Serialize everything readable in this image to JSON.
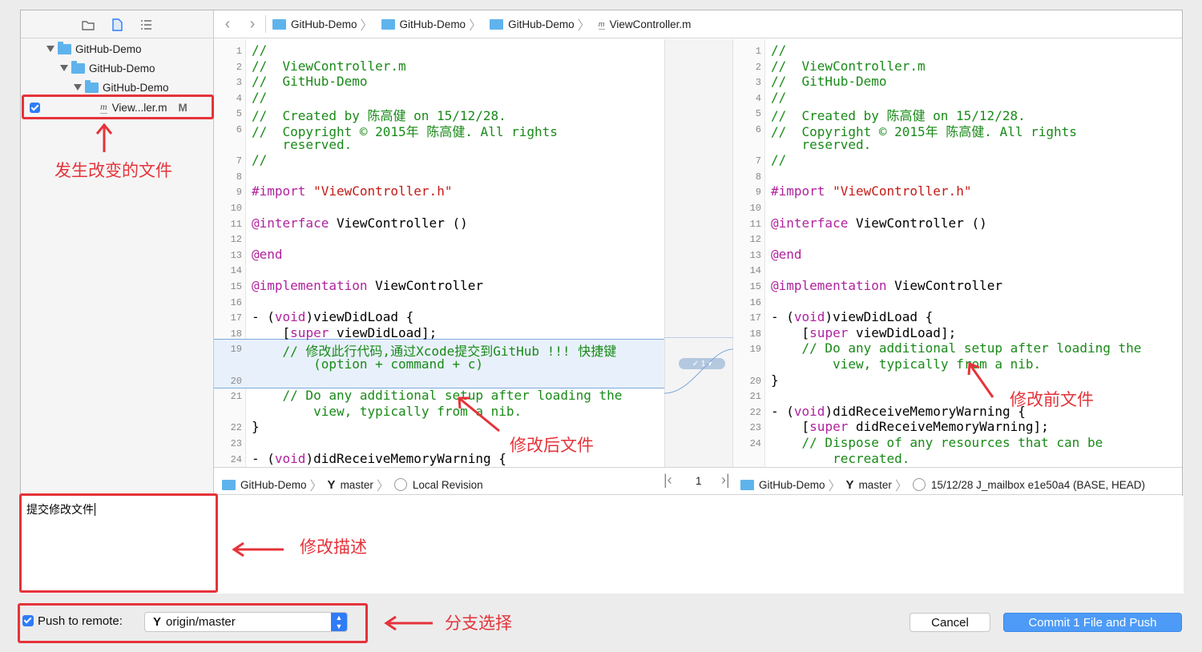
{
  "colors": {
    "accent": "#2f7cf6",
    "annotation": "#e5333a",
    "comment": "#198a18",
    "keyword": "#b0229e",
    "string": "#c41a16"
  },
  "sidebar": {
    "toolbar_icons": [
      "folder-icon",
      "file-icon",
      "list-icon"
    ],
    "tree": [
      {
        "label": "GitHub-Demo"
      },
      {
        "label": "GitHub-Demo"
      },
      {
        "label": "GitHub-Demo"
      },
      {
        "label": "View...ler.m",
        "status": "M"
      }
    ]
  },
  "jumpbar": {
    "crumbs": [
      "GitHub-Demo",
      "GitHub-Demo",
      "GitHub-Demo",
      "ViewController.m"
    ]
  },
  "left_editor": {
    "lines": [
      {
        "n": "1",
        "t": "//",
        "c": "cm"
      },
      {
        "n": "2",
        "t": "//  ViewController.m",
        "c": "cm"
      },
      {
        "n": "3",
        "t": "//  GitHub-Demo",
        "c": "cm"
      },
      {
        "n": "4",
        "t": "//",
        "c": "cm"
      },
      {
        "n": "5",
        "t": "//  Created by 陈高健 on 15/12/28.",
        "c": "cm"
      },
      {
        "n": "6",
        "t": "//  Copyright © 2015年 陈高健. All rights",
        "c": "cm"
      },
      {
        "n": "",
        "t": "    reserved.",
        "c": "cm"
      },
      {
        "n": "7",
        "t": "//",
        "c": "cm"
      },
      {
        "n": "8",
        "t": "",
        "c": ""
      },
      {
        "n": "9",
        "t": "#import \"ViewController.h\"",
        "c": "imp"
      },
      {
        "n": "10",
        "t": "",
        "c": ""
      },
      {
        "n": "11",
        "t": "@interface ViewController ()",
        "c": "iface"
      },
      {
        "n": "12",
        "t": "",
        "c": ""
      },
      {
        "n": "13",
        "t": "@end",
        "c": "kw"
      },
      {
        "n": "14",
        "t": "",
        "c": ""
      },
      {
        "n": "15",
        "t": "@implementation ViewController",
        "c": "impl"
      },
      {
        "n": "16",
        "t": "",
        "c": ""
      },
      {
        "n": "17",
        "t": "- (void)viewDidLoad {",
        "c": "meth"
      },
      {
        "n": "18",
        "t": "    [super viewDidLoad];",
        "c": "super"
      },
      {
        "n": "19",
        "t": "    // 修改此行代码,通过Xcode提交到GitHub !!! 快捷键",
        "c": "cm"
      },
      {
        "n": "",
        "t": "        (option + command + c)",
        "c": "cm"
      },
      {
        "n": "20",
        "t": "",
        "c": ""
      },
      {
        "n": "21",
        "t": "    // Do any additional setup after loading the",
        "c": "cm"
      },
      {
        "n": "",
        "t": "        view, typically from a nib.",
        "c": "cm"
      },
      {
        "n": "22",
        "t": "}",
        "c": ""
      },
      {
        "n": "23",
        "t": "",
        "c": ""
      },
      {
        "n": "24",
        "t": "- (void)didReceiveMemoryWarning {",
        "c": "meth"
      }
    ]
  },
  "right_editor": {
    "lines": [
      {
        "n": "1",
        "t": "//",
        "c": "cm"
      },
      {
        "n": "2",
        "t": "//  ViewController.m",
        "c": "cm"
      },
      {
        "n": "3",
        "t": "//  GitHub-Demo",
        "c": "cm"
      },
      {
        "n": "4",
        "t": "//",
        "c": "cm"
      },
      {
        "n": "5",
        "t": "//  Created by 陈高健 on 15/12/28.",
        "c": "cm"
      },
      {
        "n": "6",
        "t": "//  Copyright © 2015年 陈高健. All rights",
        "c": "cm"
      },
      {
        "n": "",
        "t": "    reserved.",
        "c": "cm"
      },
      {
        "n": "7",
        "t": "//",
        "c": "cm"
      },
      {
        "n": "8",
        "t": "",
        "c": ""
      },
      {
        "n": "9",
        "t": "#import \"ViewController.h\"",
        "c": "imp"
      },
      {
        "n": "10",
        "t": "",
        "c": ""
      },
      {
        "n": "11",
        "t": "@interface ViewController ()",
        "c": "iface"
      },
      {
        "n": "12",
        "t": "",
        "c": ""
      },
      {
        "n": "13",
        "t": "@end",
        "c": "kw"
      },
      {
        "n": "14",
        "t": "",
        "c": ""
      },
      {
        "n": "15",
        "t": "@implementation ViewController",
        "c": "impl"
      },
      {
        "n": "16",
        "t": "",
        "c": ""
      },
      {
        "n": "17",
        "t": "- (void)viewDidLoad {",
        "c": "meth"
      },
      {
        "n": "18",
        "t": "    [super viewDidLoad];",
        "c": "super"
      },
      {
        "n": "19",
        "t": "    // Do any additional setup after loading the",
        "c": "cm"
      },
      {
        "n": "",
        "t": "        view, typically from a nib.",
        "c": "cm"
      },
      {
        "n": "20",
        "t": "}",
        "c": ""
      },
      {
        "n": "21",
        "t": "",
        "c": ""
      },
      {
        "n": "22",
        "t": "- (void)didReceiveMemoryWarning {",
        "c": "meth"
      },
      {
        "n": "23",
        "t": "    [super didReceiveMemoryWarning];",
        "c": "super"
      },
      {
        "n": "24",
        "t": "    // Dispose of any resources that can be",
        "c": "cm"
      },
      {
        "n": "",
        "t": "        recreated.",
        "c": "cm"
      }
    ]
  },
  "diff_count": "1",
  "status_left": {
    "project": "GitHub-Demo",
    "branch": "master",
    "revision": "Local Revision"
  },
  "status_mid": {
    "page": "1"
  },
  "status_right": {
    "project": "GitHub-Demo",
    "branch": "master",
    "revision": "15/12/28  J_mailbox  e1e50a4 (BASE, HEAD)"
  },
  "commit_message": "提交修改文件",
  "push": {
    "label": "Push to remote:",
    "remote": "origin/master"
  },
  "buttons": {
    "cancel": "Cancel",
    "commit": "Commit 1 File and Push"
  },
  "annotations": {
    "changed_file": "发生改变的文件",
    "after_file": "修改后文件",
    "before_file": "修改前文件",
    "description": "修改描述",
    "branch_select": "分支选择"
  }
}
